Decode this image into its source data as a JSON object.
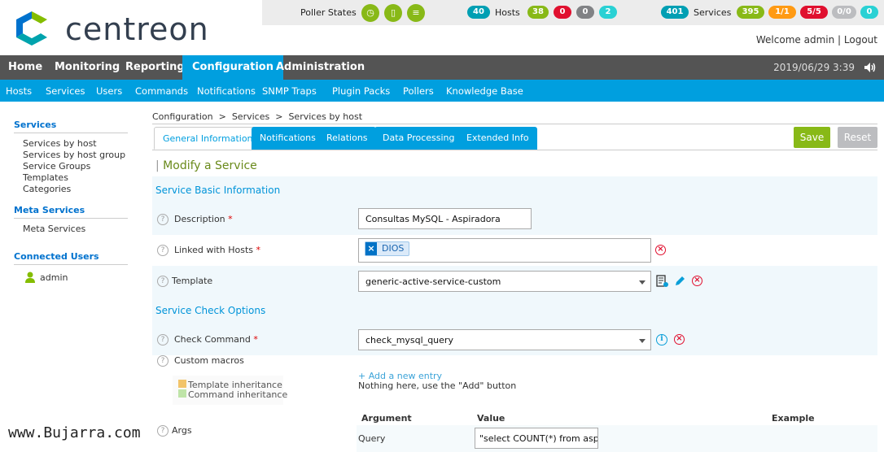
{
  "brand": {
    "logo_text": "centreon"
  },
  "stats": {
    "poller_label": "Poller States",
    "hosts": {
      "label": "Hosts",
      "total": "40",
      "up": "38",
      "down": "0",
      "unreachable": "0",
      "pending": "2"
    },
    "services": {
      "label": "Services",
      "total": "401",
      "ok": "395",
      "warning": "1/1",
      "critical": "5/5",
      "unknown": "0/0",
      "pending": "0"
    }
  },
  "user": {
    "welcome": "Welcome admin",
    "separator": "|",
    "logout": "Logout"
  },
  "main_nav": {
    "items": [
      "Home",
      "Monitoring",
      "Reporting",
      "Configuration",
      "Administration"
    ],
    "active": "Configuration",
    "clock": "2019/06/29 3:39"
  },
  "sub_nav": {
    "items": [
      "Hosts",
      "Services",
      "Users",
      "Commands",
      "Notifications",
      "SNMP Traps",
      "Plugin Packs",
      "Pollers",
      "Knowledge Base"
    ]
  },
  "sidebar": {
    "services_title": "Services",
    "services_items": [
      "Services by host",
      "Services by host group",
      "Service Groups",
      "Templates",
      "Categories"
    ],
    "meta_title": "Meta Services",
    "meta_items": [
      "Meta Services"
    ],
    "connected_title": "Connected Users",
    "connected_items": [
      "admin"
    ]
  },
  "breadcrumb": {
    "level1": "Configuration",
    "level2": "Services",
    "level3": "Services by host",
    "sep": ">"
  },
  "tabs": [
    "General Information",
    "Notifications",
    "Relations",
    "Data Processing",
    "Extended Info"
  ],
  "buttons": {
    "save": "Save",
    "reset": "Reset"
  },
  "form": {
    "title": "Modify a Service",
    "basic_section": "Service Basic Information",
    "description_label": "Description",
    "description_value": "Consultas MySQL - Aspiradora",
    "linked_hosts_label": "Linked with Hosts",
    "linked_host_tag": "DIOS",
    "template_label": "Template",
    "template_value": "generic-active-service-custom",
    "check_section": "Service Check Options",
    "check_command_label": "Check Command",
    "check_command_value": "check_mysql_query",
    "custom_macros_label": "Custom macros",
    "template_inheritance": "Template inheritance",
    "command_inheritance": "Command inheritance",
    "add_entry": "+ Add a new entry",
    "nothing_here": "Nothing here, use the \"Add\" button",
    "args_label": "Args",
    "args_headers": {
      "argument": "Argument",
      "value": "Value",
      "example": "Example"
    },
    "args_rows": [
      {
        "argument": "Query",
        "value": "\"select COUNT(*) from aspira"
      }
    ]
  },
  "watermark": "www.Bujarra.com",
  "colors": {
    "accent": "#009fdf",
    "ok": "#88b917",
    "critical": "#e0102f",
    "warning": "#ff9a13",
    "unknown": "#bcbdc0",
    "pending": "#2ad1d4",
    "nav": "#545454"
  }
}
